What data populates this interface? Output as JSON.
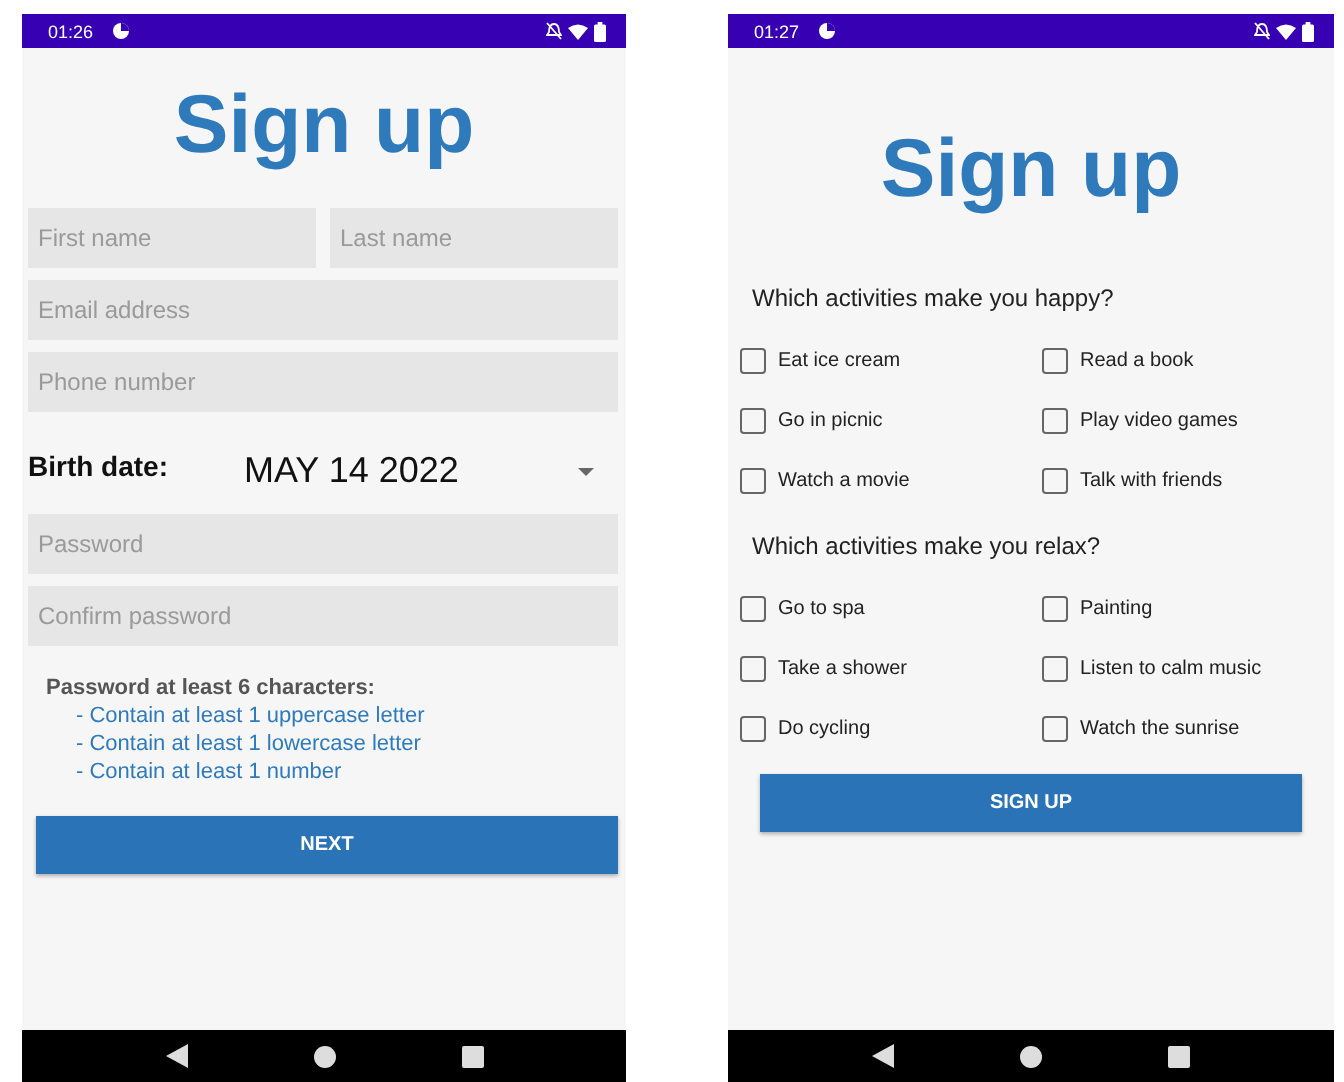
{
  "details_screen": {
    "status_time": "01:26",
    "title": "Sign up",
    "name_fields": [
      {
        "placeholder": "First name"
      },
      {
        "placeholder": "Last name"
      }
    ],
    "contact_fields": [
      {
        "placeholder": "Email address"
      },
      {
        "placeholder": "Phone number"
      }
    ],
    "birth_date": {
      "label": "Birth date:",
      "value": "MAY 14 2022"
    },
    "password_fields": [
      {
        "placeholder": "Password"
      },
      {
        "placeholder": "Confirm password"
      }
    ],
    "password_hint": {
      "title": "Password at least 6 characters:",
      "rules": [
        "- Contain at least 1 uppercase letter",
        "- Contain at least 1 lowercase letter",
        "- Contain at least 1 number"
      ]
    },
    "button": "NEXT"
  },
  "activities_screen": {
    "status_time": "01:27",
    "title": "Sign up",
    "questions": [
      {
        "text": "Which activities make you happy?",
        "options": [
          {
            "label": "Eat ice cream",
            "checked": false
          },
          {
            "label": "Read a book",
            "checked": false
          },
          {
            "label": "Go in picnic",
            "checked": false
          },
          {
            "label": "Play video games",
            "checked": false
          },
          {
            "label": "Watch a movie",
            "checked": false
          },
          {
            "label": "Talk with friends",
            "checked": false
          }
        ]
      },
      {
        "text": "Which activities make you relax?",
        "options": [
          {
            "label": "Go to spa",
            "checked": false
          },
          {
            "label": "Painting",
            "checked": false
          },
          {
            "label": "Take a shower",
            "checked": false
          },
          {
            "label": "Listen to calm music",
            "checked": false
          },
          {
            "label": "Do cycling",
            "checked": false
          },
          {
            "label": "Watch the sunrise",
            "checked": false
          }
        ]
      }
    ],
    "button": "SIGN UP"
  }
}
